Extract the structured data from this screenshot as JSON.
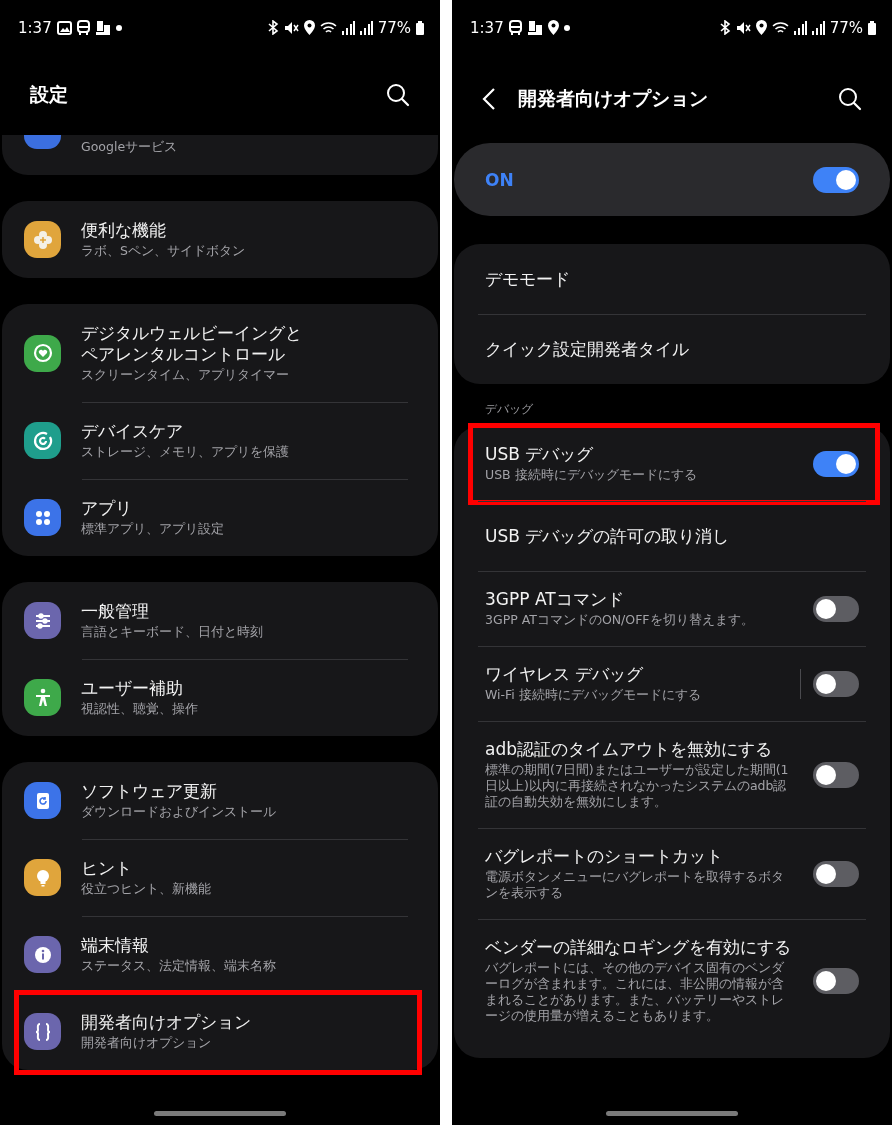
{
  "settings_screen": {
    "status_bar": {
      "time": "1:37",
      "battery": "77%"
    },
    "title": "設定",
    "groups": [
      {
        "cut_off": true,
        "items": [
          {
            "subtitle": "Googleサービス",
            "color": "#3b6fe0",
            "highlighted": false
          }
        ]
      },
      {
        "cut_off": false,
        "items": [
          {
            "title": "便利な機能",
            "subtitle": "ラボ、Sペン、サイドボタン",
            "color": "#e0a53c",
            "highlighted": false
          }
        ]
      },
      {
        "cut_off": false,
        "items": [
          {
            "title": "デジタルウェルビーイングとペアレンタルコントロール",
            "subtitle": "スクリーンタイム、アプリタイマー",
            "color": "#3ea94a",
            "highlighted": false
          },
          {
            "title": "デバイスケア",
            "subtitle": "ストレージ、メモリ、アプリを保護",
            "color": "#1f9e8c",
            "highlighted": false
          },
          {
            "title": "アプリ",
            "subtitle": "標準アプリ、アプリ設定",
            "color": "#3c73e8",
            "highlighted": false
          }
        ]
      },
      {
        "cut_off": false,
        "items": [
          {
            "title": "一般管理",
            "subtitle": "言語とキーボード、日付と時刻",
            "color": "#6b66ad",
            "highlighted": false
          },
          {
            "title": "ユーザー補助",
            "subtitle": "視認性、聴覚、操作",
            "color": "#3ea94a",
            "highlighted": false
          }
        ]
      },
      {
        "cut_off": false,
        "items": [
          {
            "title": "ソフトウェア更新",
            "subtitle": "ダウンロードおよびインストール",
            "color": "#3c73e8",
            "highlighted": false
          },
          {
            "title": "ヒント",
            "subtitle": "役立つヒント、新機能",
            "color": "#e0a53c",
            "highlighted": false
          },
          {
            "title": "端末情報",
            "subtitle": "ステータス、法定情報、端末名称",
            "color": "#6b66ad",
            "highlighted": false
          },
          {
            "title": "開発者向けオプション",
            "subtitle": "開発者向けオプション",
            "color": "#6b66ad",
            "highlighted": true
          }
        ]
      }
    ]
  },
  "developer_screen": {
    "status_bar": {
      "time": "1:37",
      "battery": "77%"
    },
    "title": "開発者向けオプション",
    "master_switch": {
      "label": "ON",
      "on": true
    },
    "groups": [
      {
        "items": [
          {
            "kind": "plain",
            "title": "デモモード",
            "highlighted": false
          },
          {
            "kind": "plain",
            "title": "クイック設定開発者タイル",
            "highlighted": false
          }
        ]
      },
      {
        "label": "デバッグ",
        "items": [
          {
            "kind": "toggle",
            "title": "USB デバッグ",
            "subtitle": "USB 接続時にデバッグモードにする",
            "on": true,
            "highlighted": true
          },
          {
            "kind": "plain",
            "title": "USB デバッグの許可の取り消し",
            "highlighted": false
          },
          {
            "kind": "toggle",
            "title": "3GPP ATコマンド",
            "subtitle": "3GPP ATコマンドのON/OFFを切り替えます。",
            "on": false,
            "highlighted": false
          },
          {
            "kind": "split_toggle",
            "title": "ワイヤレス デバッグ",
            "subtitle": "Wi-Fi 接続時にデバッグモードにする",
            "on": false,
            "highlighted": false
          },
          {
            "kind": "toggle",
            "title": "adb認証のタイムアウトを無効にする",
            "subtitle": "標準の期間(7日間)またはユーザーが設定した期間(1日以上)以内に再接続されなかったシステムのadb認証の自動失効を無効にします。",
            "on": false,
            "highlighted": false
          },
          {
            "kind": "toggle",
            "title": "バグレポートのショートカット",
            "subtitle": "電源ボタンメニューにバグレポートを取得するボタンを表示する",
            "on": false,
            "highlighted": false
          },
          {
            "kind": "toggle",
            "title": "ベンダーの詳細なロギングを有効にする",
            "subtitle": "バグレポートには、その他のデバイス固有のベンダーログが含まれます。これには、非公開の情報が含まれることがあります。また、バッテリーやストレージの使用量が増えることもあります。",
            "on": false,
            "highlighted": false
          }
        ]
      }
    ]
  }
}
